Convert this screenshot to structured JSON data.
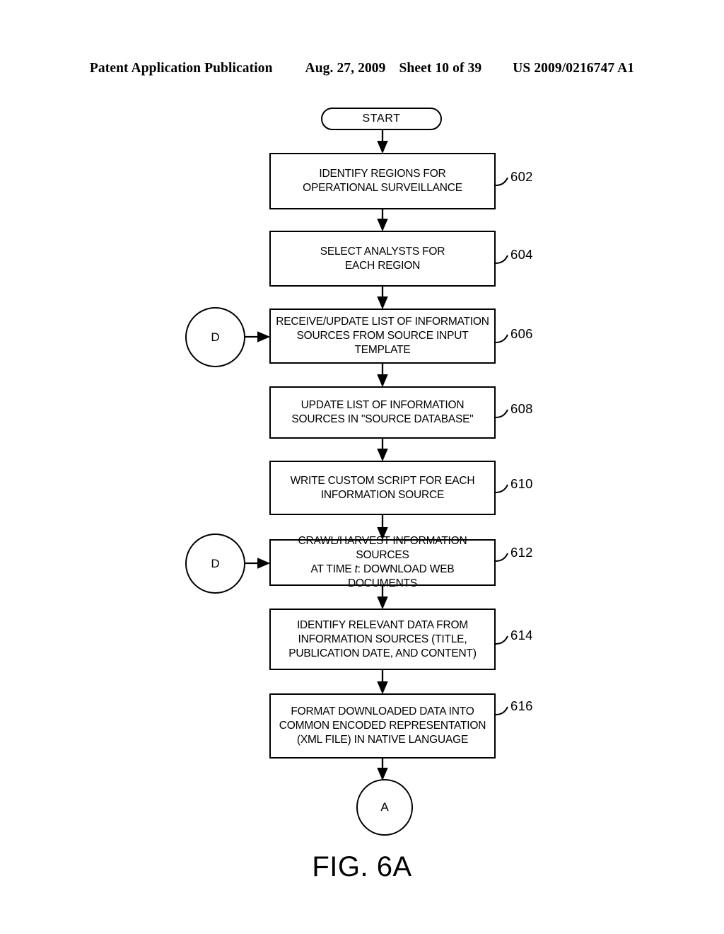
{
  "header": {
    "publication": "Patent Application Publication",
    "date": "Aug. 27, 2009",
    "sheet": "Sheet 10 of 39",
    "patent_number": "US 2009/0216747 A1"
  },
  "figure": {
    "caption": "FIG. 6A"
  },
  "diagram": {
    "type": "flowchart",
    "start": {
      "label": "START"
    },
    "steps": [
      {
        "ref": "602",
        "text": "IDENTIFY REGIONS FOR\nOPERATIONAL SURVEILLANCE"
      },
      {
        "ref": "604",
        "text": "SELECT ANALYSTS FOR\nEACH REGION"
      },
      {
        "ref": "606",
        "text": "RECEIVE/UPDATE LIST OF INFORMATION\nSOURCES FROM SOURCE INPUT TEMPLATE"
      },
      {
        "ref": "608",
        "text": "UPDATE LIST OF INFORMATION\nSOURCES IN \"SOURCE DATABASE\""
      },
      {
        "ref": "610",
        "text": "WRITE CUSTOM SCRIPT FOR EACH\nINFORMATION SOURCE"
      },
      {
        "ref": "612",
        "text_pre": "CRAWL/HARVEST INFORMATION SOURCES\nAT TIME ",
        "text_italic": "t",
        "text_post": ": DOWNLOAD WEB DOCUMENTS"
      },
      {
        "ref": "614",
        "text": "IDENTIFY RELEVANT DATA FROM\nINFORMATION SOURCES (TITLE,\nPUBLICATION DATE, AND CONTENT)"
      },
      {
        "ref": "616",
        "text": "FORMAT DOWNLOADED DATA INTO\nCOMMON ENCODED REPRESENTATION\n(XML FILE) IN NATIVE LANGUAGE"
      }
    ],
    "connectors": [
      {
        "id": "d-upper",
        "label": "D"
      },
      {
        "id": "d-lower",
        "label": "D"
      },
      {
        "id": "a-exit",
        "label": "A"
      }
    ]
  }
}
